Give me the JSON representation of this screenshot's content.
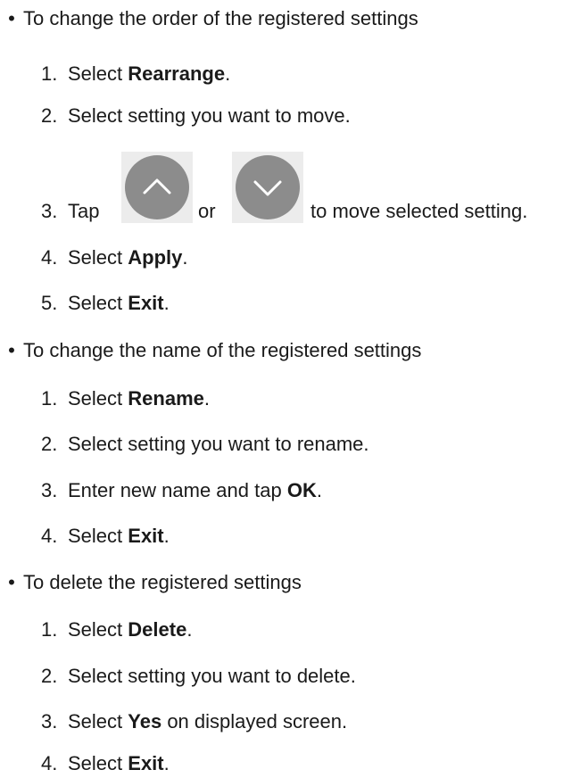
{
  "sections": [
    {
      "title": "To change the order of the registered settings",
      "steps": [
        {
          "num": "1.",
          "pre": "Select ",
          "bold": "Rearrange",
          "post": "."
        },
        {
          "num": "2.",
          "text": "Select setting you want to move."
        },
        {
          "num": "3.",
          "pre": "Tap",
          "mid": "or",
          "post": "to move selected setting."
        },
        {
          "num": "4.",
          "pre": "Select ",
          "bold": "Apply",
          "post": "."
        },
        {
          "num": "5.",
          "pre": "Select ",
          "bold": "Exit",
          "post": "."
        }
      ]
    },
    {
      "title": "To change the name of the registered settings",
      "steps": [
        {
          "num": "1.",
          "pre": "Select ",
          "bold": "Rename",
          "post": "."
        },
        {
          "num": "2.",
          "text": "Select setting you want to rename."
        },
        {
          "num": "3.",
          "pre": "Enter new name and tap ",
          "bold": "OK",
          "post": "."
        },
        {
          "num": "4.",
          "pre": "Select ",
          "bold": "Exit",
          "post": "."
        }
      ]
    },
    {
      "title": "To delete the registered settings",
      "steps": [
        {
          "num": "1.",
          "pre": "Select ",
          "bold": "Delete",
          "post": "."
        },
        {
          "num": "2.",
          "text": "Select setting you want to delete."
        },
        {
          "num": "3.",
          "pre": "Select ",
          "bold": "Yes",
          "post": " on displayed screen."
        },
        {
          "num": "4.",
          "pre": "Select ",
          "bold": "Exit",
          "post": "."
        }
      ]
    }
  ],
  "icons": {
    "up": "chevron-up-icon",
    "down": "chevron-down-icon",
    "button_color": "#8c8c8c",
    "button_bg": "#ececec"
  }
}
